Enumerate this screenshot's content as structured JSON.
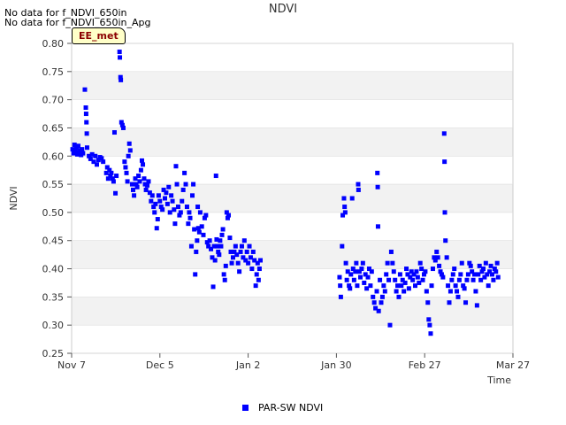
{
  "notes": [
    "No data for f_NDVI_650in",
    "No data for f_NDVI_650in_Apg"
  ],
  "tag_label": "EE_met",
  "chart_data": {
    "type": "scatter",
    "title": "NDVI",
    "xlabel": "Time",
    "ylabel": "NDVI",
    "x_ticks": [
      "Nov 7",
      "Dec 5",
      "Jan 2",
      "Jan 30",
      "Feb 27",
      "Mar 27"
    ],
    "xlim_days": [
      0,
      140
    ],
    "ylim": [
      0.25,
      0.8
    ],
    "y_ticks": [
      0.25,
      0.3,
      0.35,
      0.4,
      0.45,
      0.5,
      0.55,
      0.6,
      0.65,
      0.7,
      0.75,
      0.8
    ],
    "grid": "alternating horizontal bands",
    "legend": "bottom-center",
    "series": [
      {
        "name": "PAR-SW NDVI",
        "color": "#0000ff",
        "points": [
          [
            0.3,
            0.612
          ],
          [
            0.6,
            0.605
          ],
          [
            0.9,
            0.62
          ],
          [
            1.2,
            0.608
          ],
          [
            1.5,
            0.615
          ],
          [
            1.8,
            0.603
          ],
          [
            2.1,
            0.618
          ],
          [
            2.4,
            0.607
          ],
          [
            2.7,
            0.61
          ],
          [
            3.0,
            0.602
          ],
          [
            3.3,
            0.612
          ],
          [
            3.6,
            0.605
          ],
          [
            4.2,
            0.718
          ],
          [
            4.5,
            0.686
          ],
          [
            4.6,
            0.675
          ],
          [
            4.7,
            0.66
          ],
          [
            4.8,
            0.64
          ],
          [
            4.9,
            0.615
          ],
          [
            5.5,
            0.6
          ],
          [
            6.0,
            0.595
          ],
          [
            6.5,
            0.603
          ],
          [
            7.0,
            0.59
          ],
          [
            7.5,
            0.6
          ],
          [
            8.0,
            0.585
          ],
          [
            8.5,
            0.593
          ],
          [
            9.0,
            0.598
          ],
          [
            9.5,
            0.596
          ],
          [
            10.0,
            0.59
          ],
          [
            11.0,
            0.57
          ],
          [
            11.3,
            0.58
          ],
          [
            11.6,
            0.56
          ],
          [
            12.0,
            0.575
          ],
          [
            12.3,
            0.565
          ],
          [
            12.6,
            0.57
          ],
          [
            13.0,
            0.56
          ],
          [
            13.3,
            0.555
          ],
          [
            13.6,
            0.642
          ],
          [
            13.9,
            0.534
          ],
          [
            14.2,
            0.565
          ],
          [
            15.2,
            0.785
          ],
          [
            15.3,
            0.775
          ],
          [
            15.5,
            0.74
          ],
          [
            15.6,
            0.735
          ],
          [
            15.8,
            0.66
          ],
          [
            16.1,
            0.655
          ],
          [
            16.4,
            0.65
          ],
          [
            16.8,
            0.59
          ],
          [
            17.1,
            0.58
          ],
          [
            17.4,
            0.57
          ],
          [
            17.7,
            0.555
          ],
          [
            18.0,
            0.6
          ],
          [
            18.3,
            0.622
          ],
          [
            18.6,
            0.61
          ],
          [
            19.2,
            0.55
          ],
          [
            19.5,
            0.54
          ],
          [
            19.8,
            0.53
          ],
          [
            20.2,
            0.56
          ],
          [
            20.5,
            0.55
          ],
          [
            20.8,
            0.545
          ],
          [
            21.2,
            0.565
          ],
          [
            21.6,
            0.555
          ],
          [
            22.0,
            0.575
          ],
          [
            22.3,
            0.592
          ],
          [
            22.6,
            0.585
          ],
          [
            23.0,
            0.56
          ],
          [
            23.3,
            0.55
          ],
          [
            23.6,
            0.54
          ],
          [
            24.0,
            0.548
          ],
          [
            24.4,
            0.555
          ],
          [
            24.8,
            0.535
          ],
          [
            25.2,
            0.52
          ],
          [
            25.6,
            0.53
          ],
          [
            26.0,
            0.51
          ],
          [
            26.3,
            0.5
          ],
          [
            26.6,
            0.515
          ],
          [
            27.0,
            0.472
          ],
          [
            27.3,
            0.488
          ],
          [
            27.6,
            0.53
          ],
          [
            28.0,
            0.52
          ],
          [
            28.4,
            0.51
          ],
          [
            28.8,
            0.505
          ],
          [
            29.2,
            0.54
          ],
          [
            29.6,
            0.525
          ],
          [
            30.0,
            0.535
          ],
          [
            30.4,
            0.515
          ],
          [
            30.8,
            0.545
          ],
          [
            31.2,
            0.5
          ],
          [
            31.6,
            0.53
          ],
          [
            32.0,
            0.52
          ],
          [
            32.5,
            0.505
          ],
          [
            32.8,
            0.48
          ],
          [
            33.1,
            0.582
          ],
          [
            33.4,
            0.55
          ],
          [
            33.8,
            0.51
          ],
          [
            34.2,
            0.495
          ],
          [
            34.6,
            0.5
          ],
          [
            35.0,
            0.52
          ],
          [
            35.4,
            0.54
          ],
          [
            35.8,
            0.57
          ],
          [
            36.2,
            0.55
          ],
          [
            36.6,
            0.51
          ],
          [
            37.0,
            0.48
          ],
          [
            37.3,
            0.5
          ],
          [
            37.6,
            0.49
          ],
          [
            38.0,
            0.44
          ],
          [
            38.3,
            0.53
          ],
          [
            38.6,
            0.55
          ],
          [
            38.9,
            0.47
          ],
          [
            39.2,
            0.39
          ],
          [
            39.5,
            0.43
          ],
          [
            39.8,
            0.45
          ],
          [
            40.0,
            0.51
          ],
          [
            40.2,
            0.472
          ],
          [
            40.5,
            0.465
          ],
          [
            40.8,
            0.5
          ],
          [
            41.3,
            0.475
          ],
          [
            41.8,
            0.46
          ],
          [
            42.2,
            0.49
          ],
          [
            42.6,
            0.495
          ],
          [
            43.0,
            0.447
          ],
          [
            43.4,
            0.44
          ],
          [
            43.8,
            0.45
          ],
          [
            44.2,
            0.435
          ],
          [
            44.6,
            0.42
          ],
          [
            44.9,
            0.368
          ],
          [
            45.2,
            0.44
          ],
          [
            45.5,
            0.415
          ],
          [
            45.8,
            0.565
          ],
          [
            46.0,
            0.452
          ],
          [
            46.2,
            0.44
          ],
          [
            46.5,
            0.43
          ],
          [
            46.8,
            0.425
          ],
          [
            47.1,
            0.45
          ],
          [
            47.4,
            0.44
          ],
          [
            47.7,
            0.46
          ],
          [
            48.0,
            0.47
          ],
          [
            48.3,
            0.39
          ],
          [
            48.6,
            0.38
          ],
          [
            48.9,
            0.405
          ],
          [
            49.2,
            0.5
          ],
          [
            49.5,
            0.49
          ],
          [
            49.8,
            0.495
          ],
          [
            50.2,
            0.455
          ],
          [
            50.5,
            0.43
          ],
          [
            50.8,
            0.41
          ],
          [
            51.2,
            0.42
          ],
          [
            51.6,
            0.43
          ],
          [
            52.0,
            0.44
          ],
          [
            52.4,
            0.425
          ],
          [
            52.8,
            0.41
          ],
          [
            53.2,
            0.395
          ],
          [
            53.6,
            0.43
          ],
          [
            54.0,
            0.44
          ],
          [
            54.4,
            0.42
          ],
          [
            54.8,
            0.45
          ],
          [
            55.2,
            0.415
          ],
          [
            55.6,
            0.43
          ],
          [
            56.0,
            0.41
          ],
          [
            56.4,
            0.44
          ],
          [
            56.8,
            0.42
          ],
          [
            57.2,
            0.4
          ],
          [
            57.6,
            0.43
          ],
          [
            58.0,
            0.415
          ],
          [
            58.4,
            0.37
          ],
          [
            58.7,
            0.39
          ],
          [
            59.0,
            0.41
          ],
          [
            59.3,
            0.38
          ],
          [
            59.6,
            0.4
          ],
          [
            59.9,
            0.415
          ],
          [
            85.0,
            0.385
          ],
          [
            85.2,
            0.37
          ],
          [
            85.4,
            0.35
          ],
          [
            85.8,
            0.44
          ],
          [
            86.0,
            0.495
          ],
          [
            86.4,
            0.525
          ],
          [
            86.6,
            0.51
          ],
          [
            86.8,
            0.5
          ],
          [
            87.0,
            0.41
          ],
          [
            87.3,
            0.38
          ],
          [
            87.6,
            0.395
          ],
          [
            88.0,
            0.37
          ],
          [
            88.3,
            0.365
          ],
          [
            88.6,
            0.39
          ],
          [
            89.0,
            0.525
          ],
          [
            89.3,
            0.4
          ],
          [
            89.6,
            0.38
          ],
          [
            90.0,
            0.395
          ],
          [
            90.3,
            0.41
          ],
          [
            90.6,
            0.37
          ],
          [
            90.9,
            0.55
          ],
          [
            91.0,
            0.54
          ],
          [
            91.3,
            0.395
          ],
          [
            91.6,
            0.385
          ],
          [
            92.0,
            0.4
          ],
          [
            92.4,
            0.41
          ],
          [
            92.8,
            0.375
          ],
          [
            93.2,
            0.39
          ],
          [
            93.6,
            0.365
          ],
          [
            94.0,
            0.385
          ],
          [
            94.4,
            0.4
          ],
          [
            94.8,
            0.37
          ],
          [
            95.2,
            0.395
          ],
          [
            95.6,
            0.35
          ],
          [
            96.0,
            0.34
          ],
          [
            96.4,
            0.33
          ],
          [
            96.8,
            0.36
          ],
          [
            97.0,
            0.57
          ],
          [
            97.1,
            0.545
          ],
          [
            97.2,
            0.475
          ],
          [
            97.4,
            0.325
          ],
          [
            97.8,
            0.38
          ],
          [
            98.2,
            0.34
          ],
          [
            98.6,
            0.35
          ],
          [
            99.0,
            0.37
          ],
          [
            99.4,
            0.36
          ],
          [
            99.8,
            0.39
          ],
          [
            100.2,
            0.41
          ],
          [
            100.6,
            0.38
          ],
          [
            101.0,
            0.3
          ],
          [
            101.4,
            0.43
          ],
          [
            101.8,
            0.41
          ],
          [
            102.2,
            0.395
          ],
          [
            102.6,
            0.38
          ],
          [
            103.0,
            0.36
          ],
          [
            103.4,
            0.37
          ],
          [
            103.8,
            0.35
          ],
          [
            104.2,
            0.39
          ],
          [
            104.6,
            0.37
          ],
          [
            105.0,
            0.38
          ],
          [
            105.4,
            0.36
          ],
          [
            105.8,
            0.375
          ],
          [
            106.2,
            0.4
          ],
          [
            106.6,
            0.39
          ],
          [
            107.0,
            0.365
          ],
          [
            107.4,
            0.385
          ],
          [
            107.8,
            0.395
          ],
          [
            108.2,
            0.38
          ],
          [
            108.6,
            0.39
          ],
          [
            109.0,
            0.37
          ],
          [
            109.4,
            0.395
          ],
          [
            109.8,
            0.385
          ],
          [
            110.2,
            0.375
          ],
          [
            110.6,
            0.41
          ],
          [
            111.0,
            0.4
          ],
          [
            111.4,
            0.38
          ],
          [
            111.8,
            0.39
          ],
          [
            112.2,
            0.395
          ],
          [
            112.6,
            0.36
          ],
          [
            113.0,
            0.34
          ],
          [
            113.3,
            0.31
          ],
          [
            113.6,
            0.3
          ],
          [
            113.9,
            0.285
          ],
          [
            114.2,
            0.37
          ],
          [
            114.6,
            0.4
          ],
          [
            115.0,
            0.42
          ],
          [
            115.4,
            0.415
          ],
          [
            115.8,
            0.43
          ],
          [
            116.2,
            0.42
          ],
          [
            116.6,
            0.405
          ],
          [
            117.0,
            0.395
          ],
          [
            117.4,
            0.39
          ],
          [
            117.8,
            0.385
          ],
          [
            118.2,
            0.64
          ],
          [
            118.3,
            0.59
          ],
          [
            118.4,
            0.5
          ],
          [
            118.6,
            0.45
          ],
          [
            119.0,
            0.42
          ],
          [
            119.4,
            0.37
          ],
          [
            119.8,
            0.34
          ],
          [
            120.2,
            0.36
          ],
          [
            120.6,
            0.38
          ],
          [
            121.0,
            0.39
          ],
          [
            121.4,
            0.4
          ],
          [
            121.8,
            0.37
          ],
          [
            122.2,
            0.36
          ],
          [
            122.6,
            0.35
          ],
          [
            123.0,
            0.38
          ],
          [
            123.4,
            0.39
          ],
          [
            123.8,
            0.41
          ],
          [
            124.2,
            0.37
          ],
          [
            124.6,
            0.365
          ],
          [
            125.0,
            0.34
          ],
          [
            125.4,
            0.38
          ],
          [
            125.8,
            0.39
          ],
          [
            126.2,
            0.41
          ],
          [
            126.6,
            0.405
          ],
          [
            127.0,
            0.395
          ],
          [
            127.4,
            0.38
          ],
          [
            127.8,
            0.39
          ],
          [
            128.2,
            0.36
          ],
          [
            128.6,
            0.335
          ],
          [
            129.0,
            0.39
          ],
          [
            129.4,
            0.405
          ],
          [
            129.8,
            0.38
          ],
          [
            130.2,
            0.395
          ],
          [
            130.6,
            0.4
          ],
          [
            131.0,
            0.385
          ],
          [
            131.4,
            0.41
          ],
          [
            131.8,
            0.39
          ],
          [
            132.2,
            0.37
          ],
          [
            132.6,
            0.395
          ],
          [
            133.0,
            0.405
          ],
          [
            133.4,
            0.39
          ],
          [
            133.8,
            0.38
          ],
          [
            134.2,
            0.4
          ],
          [
            134.6,
            0.395
          ],
          [
            135.0,
            0.41
          ],
          [
            135.3,
            0.385
          ]
        ]
      }
    ]
  }
}
